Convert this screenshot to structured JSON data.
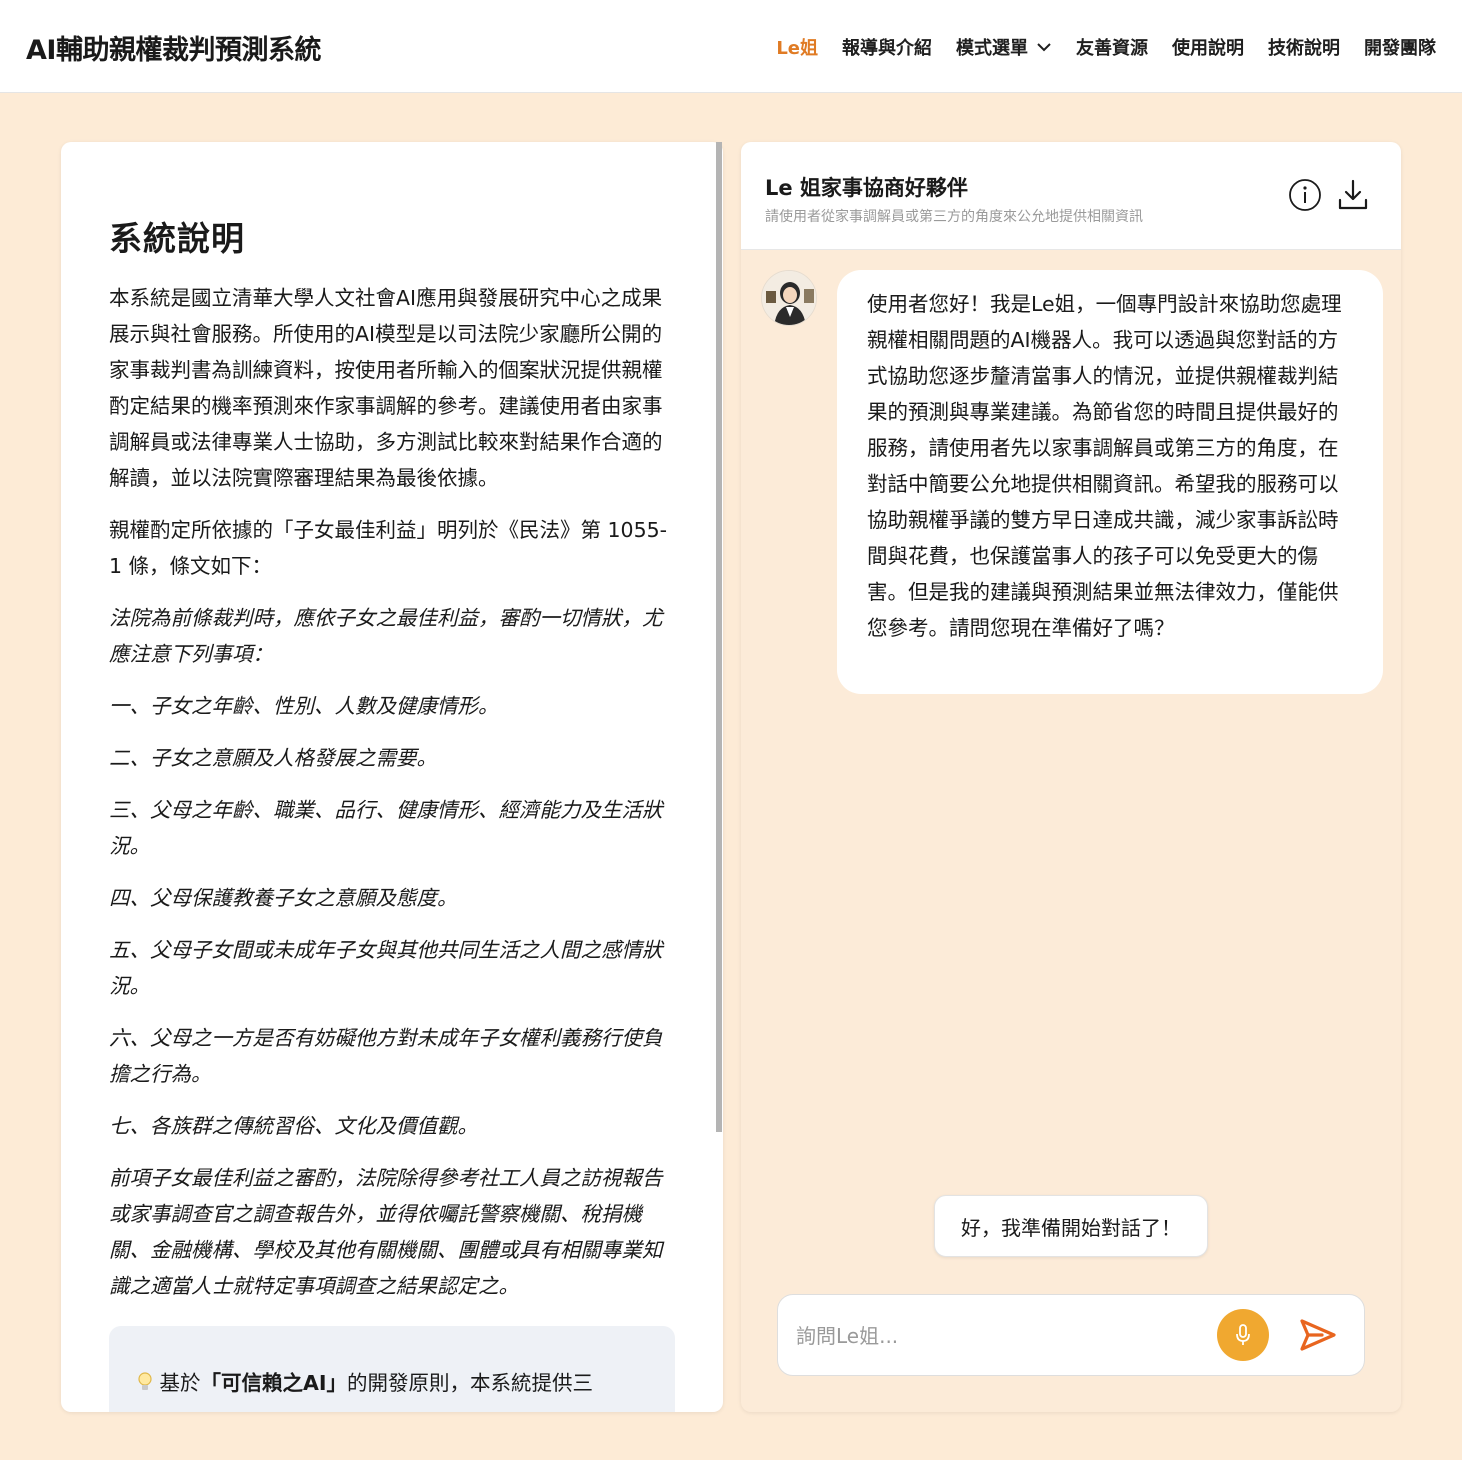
{
  "header": {
    "title": "AI輔助親權裁判預測系統",
    "nav": [
      {
        "label": "Le姐",
        "active": true
      },
      {
        "label": "報導與介紹",
        "active": false
      },
      {
        "label": "模式選單",
        "active": false,
        "has_dropdown": true
      },
      {
        "label": "友善資源",
        "active": false
      },
      {
        "label": "使用說明",
        "active": false
      },
      {
        "label": "技術說明",
        "active": false
      },
      {
        "label": "開發團隊",
        "active": false
      }
    ]
  },
  "left_panel": {
    "title": "系統說明",
    "paragraphs": [
      "本系統是國立清華大學人文社會AI應用與發展研究中心之成果展示與社會服務。所使用的AI模型是以司法院少家廳所公開的家事裁判書為訓練資料，按使用者所輸入的個案狀況提供親權酌定結果的機率預測來作家事調解的參考。建議使用者由家事調解員或法律專業人士協助，多方測試比較來對結果作合適的解讀，並以法院實際審理結果為最後依據。",
      "親權酌定所依據的「子女最佳利益」明列於《民法》第 1055-1 條，條文如下："
    ],
    "law_text": [
      "法院為前條裁判時，應依子女之最佳利益，審酌一切情狀，尤應注意下列事項：",
      "一、子女之年齡、性別、人數及健康情形。",
      "二、子女之意願及人格發展之需要。",
      "三、父母之年齡、職業、品行、健康情形、經濟能力及生活狀況。",
      "四、父母保護教養子女之意願及態度。",
      "五、父母子女間或未成年子女與其他共同生活之人間之感情狀況。",
      "六、父母之一方是否有妨礙他方對未成年子女權利義務行使負擔之行為。",
      "七、各族群之傳統習俗、文化及價值觀。",
      "前項子女最佳利益之審酌，法院除得參考社工人員之訪視報告或家事調查官之調查報告外，並得依囑託警察機關、稅捐機關、金融機構、學校及其他有關機關、團體或具有相關專業知識之適當人士就特定事項調查之結果認定之。"
    ],
    "note": {
      "prefix": "基於",
      "bold": "「可信賴之AI」",
      "suffix": "的開發原則，本系統提供三"
    }
  },
  "chat": {
    "title": "Le 姐家事協商好夥伴",
    "subtitle": "請使用者從家事調解員或第三方的角度來公允地提供相關資訊",
    "bot_message": "使用者您好！我是Le姐，一個專門設計來協助您處理親權相關問題的AI機器人。我可以透過與您對話的方式協助您逐步釐清當事人的情況，並提供親權裁判結果的預測與專業建議。為節省您的時間且提供最好的服務，請使用者先以家事調解員或第三方的角度，在對話中簡要公允地提供相關資訊。希望我的服務可以協助親權爭議的雙方早日達成共識，減少家事訴訟時間與花費，也保護當事人的孩子可以免受更大的傷害。但是我的建議與預測結果並無法律效力，僅能供您參考。請問您現在準備好了嗎？",
    "quick_reply": "好，我準備開始對話了！",
    "input_placeholder": "詢問Le姐...",
    "input_value": ""
  },
  "colors": {
    "accent": "#e07b24",
    "page_bg": "#fdebd6",
    "mic": "#f0a830",
    "send": "#e8651f"
  }
}
